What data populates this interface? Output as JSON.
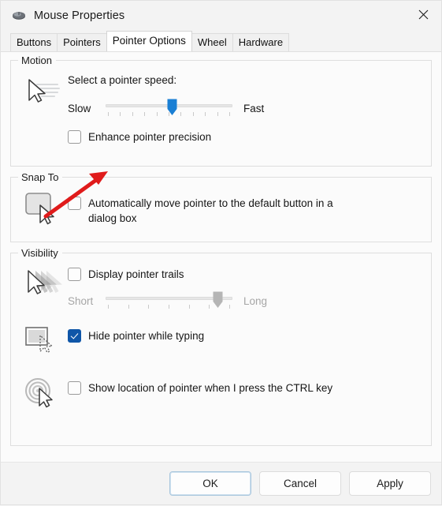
{
  "window": {
    "title": "Mouse Properties",
    "icon": "mouse-icon",
    "close_label": "close-icon"
  },
  "tabs": [
    {
      "label": "Buttons",
      "selected": false
    },
    {
      "label": "Pointers",
      "selected": false
    },
    {
      "label": "Pointer Options",
      "selected": true
    },
    {
      "label": "Wheel",
      "selected": false
    },
    {
      "label": "Hardware",
      "selected": false
    }
  ],
  "groups": {
    "motion": {
      "label": "Motion",
      "icon": "pointer-speed-icon",
      "speed_label": "Select a pointer speed:",
      "slider": {
        "left_label": "Slow",
        "right_label": "Fast",
        "value": 52,
        "min": 0,
        "max": 100,
        "ticks": 11,
        "enabled": true
      },
      "checkbox": {
        "label": "Enhance pointer precision",
        "checked": false
      }
    },
    "snap_to": {
      "label": "Snap To",
      "icon": "default-button-cursor-icon",
      "checkbox": {
        "label": "Automatically move pointer to the default button in a dialog box",
        "checked": false
      }
    },
    "visibility": {
      "label": "Visibility",
      "trails": {
        "icon": "pointer-trails-icon",
        "checkbox": {
          "label": "Display pointer trails",
          "checked": false
        },
        "slider": {
          "left_label": "Short",
          "right_label": "Long",
          "value": 88,
          "min": 0,
          "max": 100,
          "ticks": 7,
          "enabled": false
        }
      },
      "hide_typing": {
        "icon": "hide-pointer-typing-icon",
        "checkbox": {
          "label": "Hide pointer while typing",
          "checked": true
        }
      },
      "show_location": {
        "icon": "pointer-location-radar-icon",
        "checkbox": {
          "label": "Show location of pointer when I press the CTRL key",
          "checked": false
        }
      }
    }
  },
  "footer": {
    "ok": "OK",
    "cancel": "Cancel",
    "apply": "Apply"
  },
  "annotation": {
    "type": "red-arrow",
    "color": "#e01b1b",
    "points_to": "Enhance pointer precision"
  },
  "colors": {
    "accent": "#0f56a8",
    "slider_thumb": "#1a7fd4",
    "slider_thumb_disabled": "#b5b5b5",
    "window_bg": "#f3f3f3",
    "page_bg": "#fbfbfb",
    "annotation": "#e01b1b"
  }
}
